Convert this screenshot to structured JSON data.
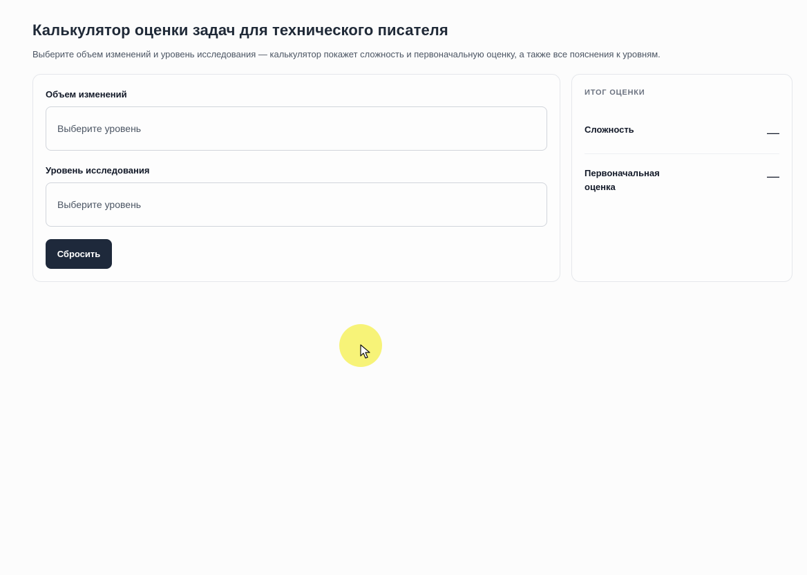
{
  "header": {
    "title": "Калькулятор оценки задач для технического писателя",
    "subtitle": "Выберите объем изменений и уровень исследования — калькулятор покажет сложность и первоначальную оценку, а также все пояснения к уровням."
  },
  "form": {
    "volume_label": "Объем изменений",
    "volume_placeholder": "Выберите уровень",
    "research_label": "Уровень исследования",
    "research_placeholder": "Выберите уровень",
    "reset_label": "Сбросить"
  },
  "result": {
    "heading": "Итог оценки",
    "complexity_label": "Сложность",
    "complexity_value": "—",
    "estimate_label": "Первоначальная оценка",
    "estimate_value": "—"
  },
  "colors": {
    "background": "#fcfcfc",
    "button": "#1e293b",
    "cursor_highlight": "#f5f05a"
  },
  "icons": {
    "cursor": "mouse-pointer-icon"
  }
}
